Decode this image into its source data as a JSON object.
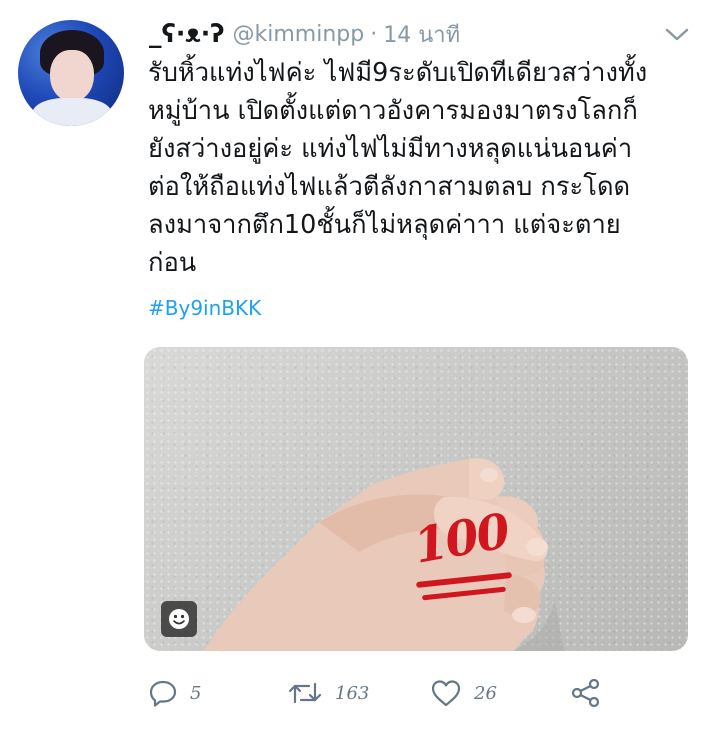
{
  "tweet": {
    "display_name": "_ʕ·ᴥ·ʔ",
    "handle": "@kimminpp",
    "separator": "·",
    "time": "14 นาที",
    "text": "รับหิ้วแท่งไฟค่ะ ไฟมี9ระดับเปิดทีเดียวสว่างทั้ง\nหมู่บ้าน เปิดตั้งแต่ดาวอังคารมองมาตรงโลกก็\nยังสว่างอยู่ค่ะ แท่งไฟไม่มีทางหลุดแน่นอนค่า\nต่อให้ถือแท่งไฟแล้วตีลังกาสามตลบ กระโดด\nลงมาจากตึก10ชั้นก็ไม่หลุดค่าาา แต่จะตาย\nก่อน",
    "hashtag": "#By9inBKK",
    "sticker_text": "100"
  },
  "actions": {
    "reply_count": "5",
    "retweet_count": "163",
    "like_count": "26"
  },
  "colors": {
    "link": "#1da1f2",
    "muted": "#8899a6",
    "text": "#14171a",
    "sticker_red": "#d0161f"
  },
  "icons": [
    "chevron-down-icon",
    "reply-icon",
    "retweet-icon",
    "heart-icon",
    "share-icon",
    "sticker-icon"
  ]
}
